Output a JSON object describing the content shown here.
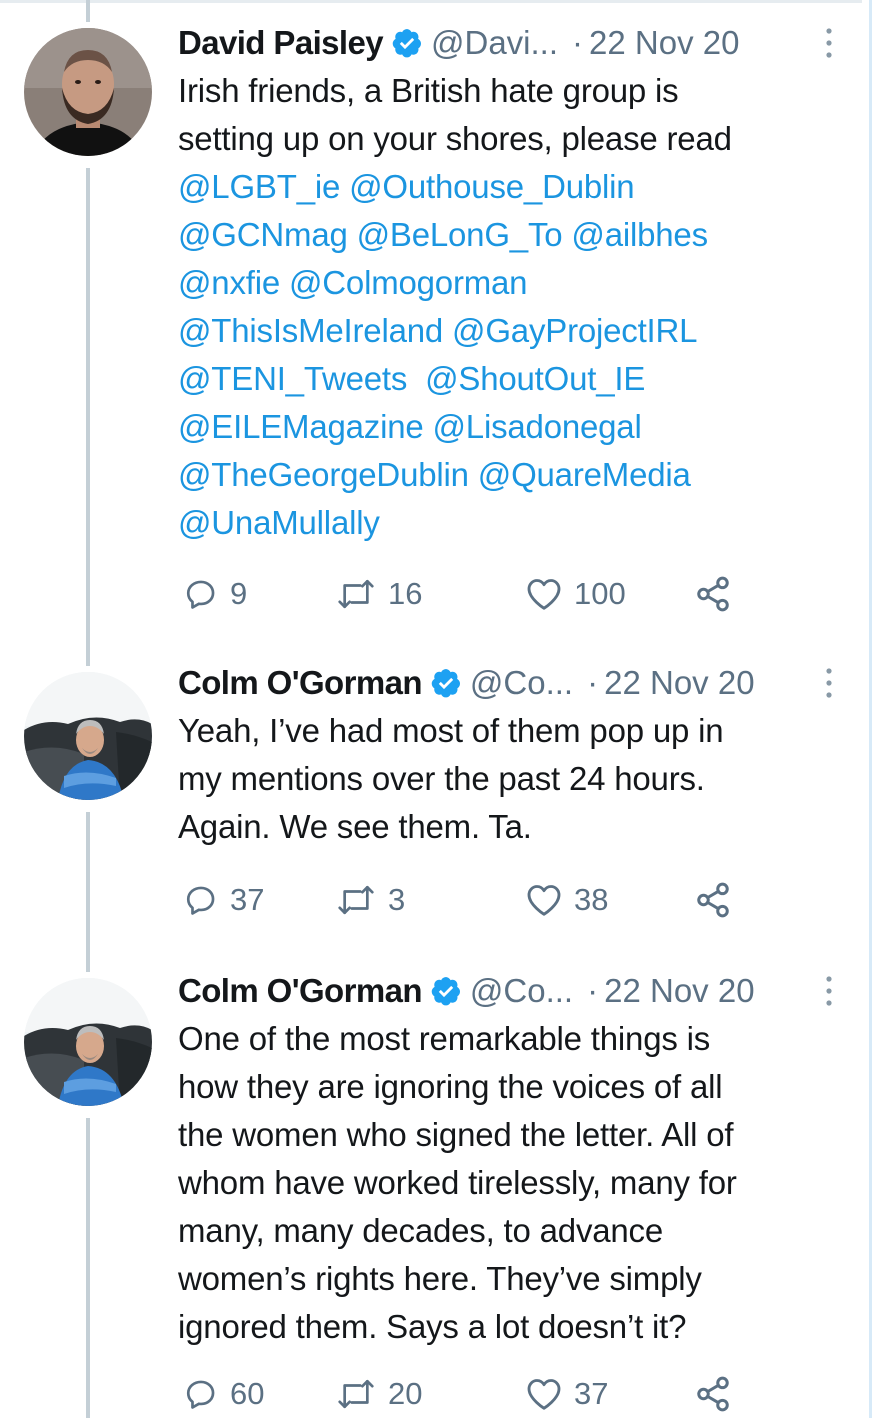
{
  "tweets": [
    {
      "display_name": "David Paisley",
      "handle": "@Davi...",
      "separator": "·",
      "date": "22 Nov 20",
      "text_lines": [
        {
          "segments": [
            {
              "text": "Irish friends, a British hate group is",
              "type": "plain"
            }
          ]
        },
        {
          "segments": [
            {
              "text": "setting up on your shores, please read",
              "type": "plain"
            }
          ]
        },
        {
          "segments": [
            {
              "text": "@LGBT_ie",
              "type": "mention"
            },
            {
              "text": " ",
              "type": "plain"
            },
            {
              "text": "@Outhouse_Dublin",
              "type": "mention"
            }
          ]
        },
        {
          "segments": [
            {
              "text": "@GCNmag",
              "type": "mention"
            },
            {
              "text": " ",
              "type": "plain"
            },
            {
              "text": "@BeLonG_To",
              "type": "mention"
            },
            {
              "text": " ",
              "type": "plain"
            },
            {
              "text": "@ailbhes",
              "type": "mention"
            }
          ]
        },
        {
          "segments": [
            {
              "text": "@nxfie",
              "type": "mention"
            },
            {
              "text": " ",
              "type": "plain"
            },
            {
              "text": "@Colmogorman",
              "type": "mention"
            }
          ]
        },
        {
          "segments": [
            {
              "text": "@ThisIsMeIreland",
              "type": "mention"
            },
            {
              "text": " ",
              "type": "plain"
            },
            {
              "text": "@GayProjectIRL",
              "type": "mention"
            }
          ]
        },
        {
          "segments": [
            {
              "text": "@TENI_Tweets",
              "type": "mention"
            },
            {
              "text": "  ",
              "type": "plain"
            },
            {
              "text": "@ShoutOut_IE",
              "type": "mention"
            }
          ]
        },
        {
          "segments": [
            {
              "text": "@EILEMagazine",
              "type": "mention"
            },
            {
              "text": " ",
              "type": "plain"
            },
            {
              "text": "@Lisadonegal",
              "type": "mention"
            }
          ]
        },
        {
          "segments": [
            {
              "text": "@TheGeorgeDublin",
              "type": "mention"
            },
            {
              "text": " ",
              "type": "plain"
            },
            {
              "text": "@QuareMedia",
              "type": "mention"
            }
          ]
        },
        {
          "segments": [
            {
              "text": "@UnaMullally",
              "type": "mention"
            }
          ]
        }
      ],
      "replies": "9",
      "retweets": "16",
      "likes": "100"
    },
    {
      "display_name": "Colm O'Gorman",
      "handle": "@Co...",
      "separator": "·",
      "date": "22 Nov 20",
      "text_lines": [
        {
          "segments": [
            {
              "text": "Yeah, I’ve had most of them pop up in",
              "type": "plain"
            }
          ]
        },
        {
          "segments": [
            {
              "text": "my mentions over the past 24 hours.",
              "type": "plain"
            }
          ]
        },
        {
          "segments": [
            {
              "text": "Again. We see them. Ta.",
              "type": "plain"
            }
          ]
        }
      ],
      "replies": "37",
      "retweets": "3",
      "likes": "38"
    },
    {
      "display_name": "Colm O'Gorman",
      "handle": "@Co...",
      "separator": "·",
      "date": "22 Nov 20",
      "text_lines": [
        {
          "segments": [
            {
              "text": "One of the most remarkable things is",
              "type": "plain"
            }
          ]
        },
        {
          "segments": [
            {
              "text": "how they are ignoring the voices of all",
              "type": "plain"
            }
          ]
        },
        {
          "segments": [
            {
              "text": "the women who signed the letter. All of",
              "type": "plain"
            }
          ]
        },
        {
          "segments": [
            {
              "text": "whom have worked tirelessly, many for",
              "type": "plain"
            }
          ]
        },
        {
          "segments": [
            {
              "text": "many, many decades, to advance",
              "type": "plain"
            }
          ]
        },
        {
          "segments": [
            {
              "text": "women’s rights here. They’ve simply",
              "type": "plain"
            }
          ]
        },
        {
          "segments": [
            {
              "text": "ignored them. Says a lot doesn’t it?",
              "type": "plain"
            }
          ]
        }
      ],
      "replies": "60",
      "retweets": "20",
      "likes": "37"
    }
  ],
  "colors": {
    "mention": "#1b95e0",
    "secondary_text": "#5b7083",
    "verified": "#1da1f2",
    "thread_line": "#c4cfd6"
  },
  "icons": [
    "verified-badge-icon",
    "more-options-icon",
    "reply-icon",
    "retweet-icon",
    "like-icon",
    "share-icon"
  ]
}
